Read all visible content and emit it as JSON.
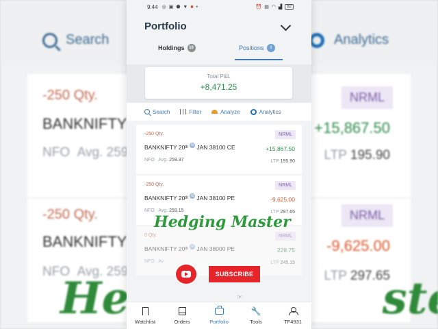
{
  "status": {
    "time": "9:44",
    "battery": "82"
  },
  "header": {
    "title": "Portfolio"
  },
  "tabs": [
    {
      "label": "Holdings",
      "count": "10"
    },
    {
      "label": "Positions",
      "count": "3"
    }
  ],
  "pnl": {
    "label": "Total P&L",
    "value": "+8,471.25"
  },
  "toolbar": {
    "search": "Search",
    "filter": "Filter",
    "analyze": "Analyze",
    "analytics": "Analytics"
  },
  "positions": [
    {
      "qty": "-250",
      "qty_unit": "Qty.",
      "symbol": "BANKNIFTY 20",
      "sup": "th",
      "contract": "JAN 38100 CE",
      "exchange": "NFO",
      "avg_label": "Avg.",
      "avg": "259.37",
      "product": "NRML",
      "pnl": "+15,867.50",
      "ltp_label": "LTP",
      "ltp": "195.90"
    },
    {
      "qty": "-250",
      "qty_unit": "Qty.",
      "symbol": "BANKNIFTY 20",
      "sup": "th",
      "contract": "JAN 38100 PE",
      "exchange": "NFO",
      "avg_label": "Avg.",
      "avg": "259.15",
      "product": "NRML",
      "pnl": "-9,625.00",
      "ltp_label": "LTP",
      "ltp": "297.65"
    },
    {
      "qty": "0",
      "qty_unit": "Qty.",
      "symbol": "BANKNIFTY 20",
      "sup": "th",
      "contract": "JAN 38000 PE",
      "exchange": "NFO",
      "avg_label": "Av",
      "avg": "",
      "product": "NRML",
      "pnl": "228.75",
      "ltp_label": "LTP",
      "ltp": "245.15"
    }
  ],
  "overlay": {
    "title": "Hedging Master",
    "subscribe": "SUBSCRIBE"
  },
  "nav": [
    {
      "label": "Watchlist"
    },
    {
      "label": "Orders"
    },
    {
      "label": "Portfolio"
    },
    {
      "label": "Tools"
    },
    {
      "label": "TF4931"
    }
  ],
  "background": {
    "search": "Search",
    "analytics": "Analytics",
    "cards": [
      {
        "qty": "-250 Qty.",
        "symbol": "BANKNIFTY",
        "exchange": "NFO",
        "avg": "Avg. 259",
        "product": "NRML",
        "pnl": "+15,867.50",
        "ltp_label": "LTP",
        "ltp": "195.90"
      },
      {
        "qty": "-250 Qty.",
        "symbol": "BANKNIFTY",
        "exchange": "NFO",
        "avg": "Avg. 259",
        "product": "NRML",
        "pnl": "-9,625.00",
        "ltp_label": "LTP",
        "ltp": "297.65"
      }
    ],
    "watermark_left": "Hedg",
    "watermark_right": "ster"
  },
  "colors": {
    "accent": "#3f78b5",
    "profit": "#2e8b4a",
    "loss": "#d85a2e",
    "product_tag": "#7e5fa8",
    "youtube": "#e6242a"
  }
}
